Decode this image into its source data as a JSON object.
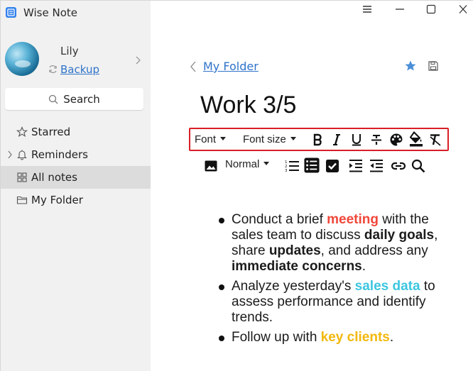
{
  "app": {
    "title": "Wise Note"
  },
  "user": {
    "name": "Lily",
    "backup_label": "Backup"
  },
  "sidebar": {
    "search_label": "Search",
    "items": [
      {
        "label": "Starred",
        "icon": "star-outline-icon"
      },
      {
        "label": "Reminders",
        "icon": "bell-icon"
      },
      {
        "label": "All notes",
        "icon": "grid-icon",
        "active": true
      },
      {
        "label": "My Folder",
        "icon": "folder-icon"
      }
    ]
  },
  "note": {
    "breadcrumb": "My Folder",
    "title": "Work 3/5"
  },
  "toolbar": {
    "font_label": "Font",
    "font_size_label": "Font size",
    "paragraph_style": "Normal"
  },
  "content": {
    "bullets": [
      {
        "segments": [
          {
            "text": "Conduct a brief ",
            "style": "normal"
          },
          {
            "text": "meeting",
            "style": "red"
          },
          {
            "text": " with the sales team to discuss ",
            "style": "normal"
          },
          {
            "text": "daily goals",
            "style": "bold"
          },
          {
            "text": ", share ",
            "style": "normal"
          },
          {
            "text": "updates",
            "style": "bold"
          },
          {
            "text": ", and address any ",
            "style": "normal"
          },
          {
            "text": "immediate concerns",
            "style": "bold"
          },
          {
            "text": ".",
            "style": "normal"
          }
        ]
      },
      {
        "segments": [
          {
            "text": "Analyze yesterday's ",
            "style": "normal"
          },
          {
            "text": "sales data",
            "style": "cyan"
          },
          {
            "text": " to assess performance and identify trends.",
            "style": "normal"
          }
        ]
      },
      {
        "segments": [
          {
            "text": "Follow up with ",
            "style": "normal"
          },
          {
            "text": "key clients",
            "style": "yellow"
          },
          {
            "text": ".",
            "style": "normal"
          }
        ]
      }
    ]
  },
  "colors": {
    "accent": "#2f73c9",
    "toolbar_border": "#d81f26",
    "highlight_red": "#f0473a",
    "highlight_cyan": "#3cc6e0",
    "highlight_yellow": "#f2b80c",
    "star": "#4a8fd8"
  }
}
